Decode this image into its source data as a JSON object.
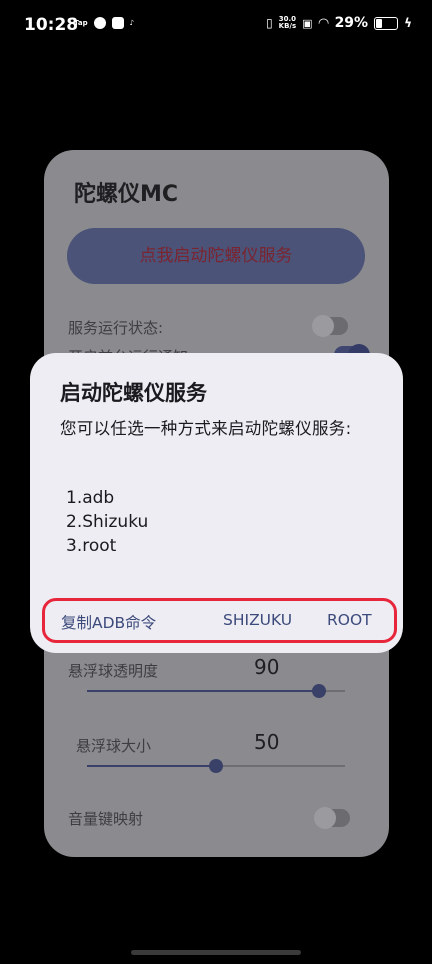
{
  "status_bar": {
    "time": "10:28",
    "left_icons": [
      "tap-icon",
      "swirl-app-icon",
      "mail-icon",
      "tiktok-icon"
    ],
    "tap_label": "Tap",
    "speed_value": "30.0",
    "speed_unit": "KB/s",
    "battery_percent": "29%",
    "battery_level": 29
  },
  "app": {
    "title": "陀螺仪MC",
    "start_button": "点我启动陀螺仪服务",
    "service_status_label": "服务运行状态:",
    "floating_notice_label": "开启前台运行通知",
    "opacity_label": "悬浮球透明度",
    "opacity_value": "90",
    "opacity_level": 90,
    "size_label": "悬浮球大小",
    "size_value": "50",
    "size_level": 50,
    "volume_key_label": "音量键映射"
  },
  "dialog": {
    "title": "启动陀螺仪服务",
    "message": "您可以任选一种方式来启动陀螺仪服务:",
    "options": [
      "1.adb",
      "2.Shizuku",
      "3.root"
    ],
    "actions": {
      "copy_adb": "复制ADB命令",
      "shizuku": "SHIZUKU",
      "root": "ROOT"
    }
  },
  "colors": {
    "highlight_border": "#e8263b",
    "action_text": "#3c4a7c",
    "dialog_bg": "#eeedf3"
  }
}
